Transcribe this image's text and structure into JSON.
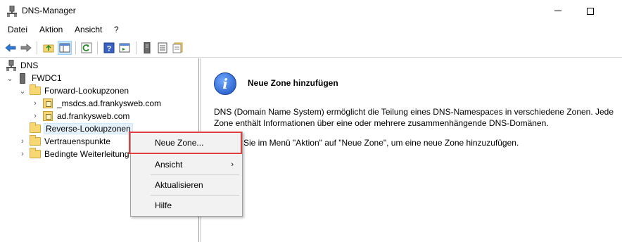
{
  "window": {
    "title": "DNS-Manager"
  },
  "menu": {
    "items": [
      "Datei",
      "Aktion",
      "Ansicht",
      "?"
    ]
  },
  "toolbar": {
    "buttons": [
      "back-icon",
      "forward-icon",
      "up-folder-icon",
      "show-hide-console-tree-icon",
      "refresh-icon",
      "help-icon",
      "action-pane-icon",
      "server-icon",
      "list-icon",
      "properties-icon"
    ]
  },
  "tree": {
    "root": "DNS",
    "server": "FWDC1",
    "forward": "Forward-Lookupzonen",
    "zone1": "_msdcs.ad.frankysweb.com",
    "zone2": "ad.frankysweb.com",
    "reverse": "Reverse-Lookupzonen",
    "trust": "Vertrauenspunkte",
    "conditional": "Bedingte Weiterleitung"
  },
  "detail": {
    "title": "Neue Zone hinzufügen",
    "paragraph1": "DNS (Domain Name System) ermöglicht die Teilung eines DNS-Namespaces in verschiedene Zonen. Jede Zone enthält Informationen über eine oder mehrere zusammenhängende DNS-Domänen.",
    "paragraph2": "Sie im Menü \"Aktion\" auf \"Neue Zone\", um eine neue Zone hinzuzufügen."
  },
  "context_menu": {
    "new_zone": "Neue Zone...",
    "view": "Ansicht",
    "refresh": "Aktualisieren",
    "help": "Hilfe"
  },
  "colors": {
    "selection": "#e5f1fb",
    "highlight_border": "#e04040",
    "folder": "#f7d774"
  }
}
